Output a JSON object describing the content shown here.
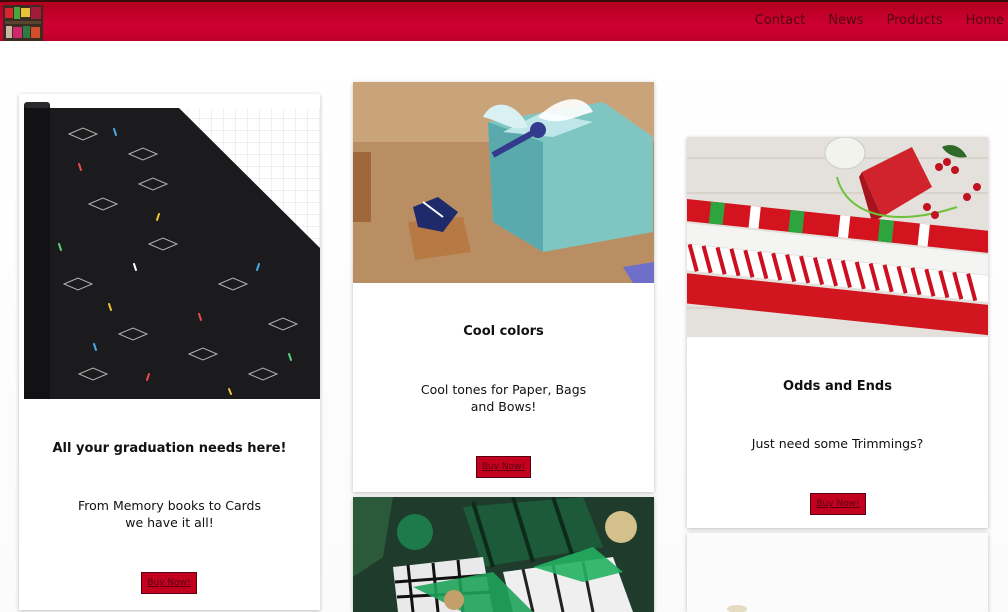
{
  "nav": {
    "items": [
      "Contact",
      "News",
      "Products",
      "Home"
    ]
  },
  "cards": [
    {
      "title": "All your graduation needs here!",
      "text": "From Memory books to Cards we have it all!",
      "button": "Buy Now!"
    },
    {
      "title": "Cool colors",
      "text": "Cool tones for Paper, Bags and Bows!",
      "button": "Buy Now!"
    },
    {
      "title": "Odds and Ends",
      "text": "Just need some Trimmings?",
      "button": "Buy Now!"
    }
  ],
  "icons": {
    "logo": "store-logo-icon"
  }
}
